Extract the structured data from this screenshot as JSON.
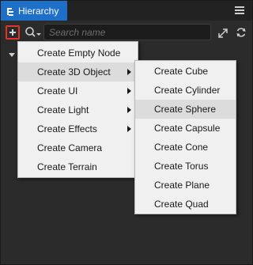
{
  "panel": {
    "tab_label": "Hierarchy",
    "accent_color": "#1e6fc8"
  },
  "toolbar": {
    "add_icon": "plus-icon",
    "search_type_icon": "search-icon",
    "search_placeholder": "Search name",
    "search_value": "",
    "collapse_icon": "collapse-icon",
    "refresh_icon": "refresh-icon"
  },
  "create_menu": {
    "items": [
      {
        "label": "Create Empty Node",
        "has_submenu": false
      },
      {
        "label": "Create 3D Object",
        "has_submenu": true,
        "active": true
      },
      {
        "label": "Create UI",
        "has_submenu": true
      },
      {
        "label": "Create Light",
        "has_submenu": true
      },
      {
        "label": "Create Effects",
        "has_submenu": true
      },
      {
        "label": "Create Camera",
        "has_submenu": false
      },
      {
        "label": "Create Terrain",
        "has_submenu": false
      }
    ]
  },
  "submenu_3d": {
    "items": [
      {
        "label": "Create Cube"
      },
      {
        "label": "Create Cylinder"
      },
      {
        "label": "Create Sphere",
        "hovered": true
      },
      {
        "label": "Create Capsule"
      },
      {
        "label": "Create Cone"
      },
      {
        "label": "Create Torus"
      },
      {
        "label": "Create Plane"
      },
      {
        "label": "Create Quad"
      }
    ]
  }
}
